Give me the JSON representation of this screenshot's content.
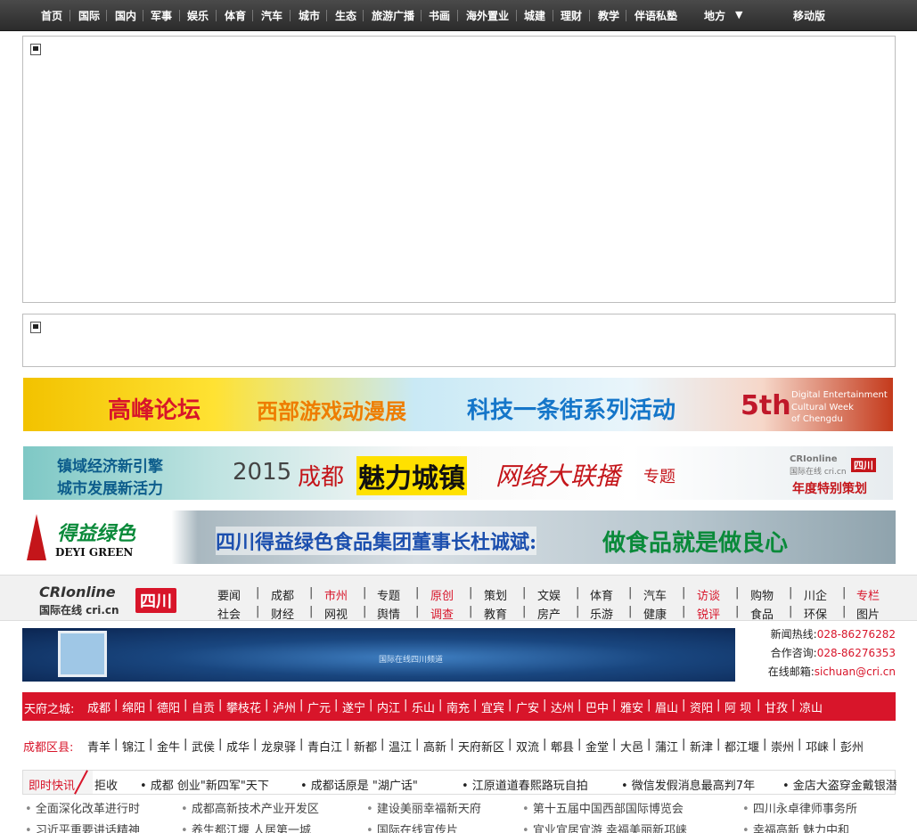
{
  "top_nav": {
    "items": [
      "首页",
      "国际",
      "国内",
      "军事",
      "娱乐",
      "体育",
      "汽车",
      "城市",
      "生态",
      "旅游广播",
      "书画",
      "海外置业",
      "城建",
      "理财",
      "教学",
      "伴语私塾"
    ],
    "local_label": "地方",
    "local_arrow": "▼",
    "mobile_label": "移动版"
  },
  "banners": {
    "forum": {
      "t1": "高峰论坛",
      "t2": "西部游戏动漫展",
      "t3": "科技一条街系列活动",
      "t4": "5th",
      "t5": "Digital Entertainment",
      "t6": "Cultural Week",
      "t7": "of Chengdu"
    },
    "towns": {
      "t1": "镇域经济新引擎",
      "t2": "城市发展新活力",
      "t3": "2015",
      "t4": "成都",
      "t5": "魅力城镇",
      "t6": "网络大联播",
      "t7": "专题",
      "t8": "年度特别策划",
      "logo": "CRIonline",
      "logo_sub": "国际在线 cri.cn",
      "badge": "四川"
    },
    "deyi": {
      "brand_cn": "得益绿色",
      "brand_en": "DEYI GREEN",
      "headline_1": "四川得益绿色食品集团董事长杜诚斌:",
      "headline_2": "做食品就是做良心"
    }
  },
  "channel": {
    "logo_main": "CRIonline",
    "logo_sub": "国际在线 cri.cn",
    "logo_badge": "四川",
    "row1": [
      {
        "label": "要闻",
        "red": false
      },
      {
        "label": "成都",
        "red": false
      },
      {
        "label": "市州",
        "red": true
      },
      {
        "label": "专题",
        "red": false
      },
      {
        "label": "原创",
        "red": true
      },
      {
        "label": "策划",
        "red": false
      },
      {
        "label": "文娱",
        "red": false
      },
      {
        "label": "体育",
        "red": false
      },
      {
        "label": "汽车",
        "red": false
      },
      {
        "label": "访谈",
        "red": true
      },
      {
        "label": "购物",
        "red": false
      },
      {
        "label": "川企",
        "red": false
      },
      {
        "label": "专栏",
        "red": true
      }
    ],
    "row2": [
      {
        "label": "社会",
        "red": false
      },
      {
        "label": "财经",
        "red": false
      },
      {
        "label": "网视",
        "red": false
      },
      {
        "label": "舆情",
        "red": false
      },
      {
        "label": "调查",
        "red": true
      },
      {
        "label": "教育",
        "red": false
      },
      {
        "label": "房产",
        "red": false
      },
      {
        "label": "乐游",
        "red": false
      },
      {
        "label": "健康",
        "red": false
      },
      {
        "label": "锐评",
        "red": true
      },
      {
        "label": "食品",
        "red": false
      },
      {
        "label": "环保",
        "red": false
      },
      {
        "label": "图片",
        "red": false
      }
    ]
  },
  "hot_banner": {
    "caption": "国际在线四川频道"
  },
  "contact": {
    "news_hotline_label": "新闻热线:",
    "news_hotline": "028-86276282",
    "coop_label": "合作咨询:",
    "coop": "028-86276353",
    "email_label": "在线邮箱:",
    "email": "sichuan@cri.cn"
  },
  "cities": {
    "label": "天府之城:",
    "items": [
      "成都",
      "绵阳",
      "德阳",
      "自贡",
      "攀枝花",
      "泸州",
      "广元",
      "遂宁",
      "内江",
      "乐山",
      "南充",
      "宜宾",
      "广安",
      "达州",
      "巴中",
      "雅安",
      "眉山",
      "资阳",
      "阿 坝",
      "甘孜",
      "凉山"
    ]
  },
  "districts": {
    "label": "成都区县:",
    "items": [
      "青羊",
      "锦江",
      "金牛",
      "武侯",
      "成华",
      "龙泉驿",
      "青白江",
      "新都",
      "温江",
      "高新",
      "天府新区",
      "双流",
      "郫县",
      "金堂",
      "大邑",
      "蒲江",
      "新津",
      "都江堰",
      "崇州",
      "邛崃",
      "彭州"
    ]
  },
  "flash": {
    "tag": "即时快讯",
    "items": [
      "拒收",
      "• 成都 创业\"新四军\"天下",
      "• 成都话原是 \"湖广话\"",
      "• 江原道道春熙路玩自拍",
      "• 微信发假消息最高判7年",
      "• 金店大盗穿金戴银潜"
    ]
  },
  "news_rows": [
    [
      "全面深化改革进行时",
      "成都高新技术产业开发区",
      "建设美丽幸福新天府",
      "第十五届中国西部国际博览会",
      "四川永卓律师事务所"
    ],
    [
      "习近平重要讲话精神",
      "养生都江堰 人居第一城",
      "国际在线宣传片",
      "宜业宜居宜游 幸福美丽新邛崃",
      "幸福高新 魅力中和"
    ]
  ]
}
